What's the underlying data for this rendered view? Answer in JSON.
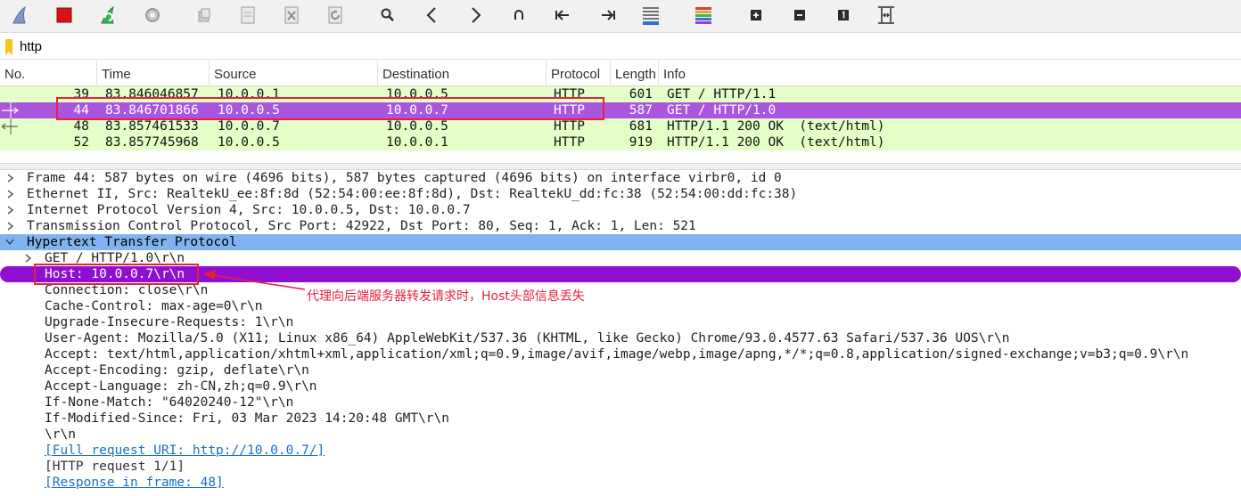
{
  "toolbar": {
    "buttons": [
      {
        "name": "shark-fin-start-icon",
        "color": "#5b6f9e"
      },
      {
        "name": "stop-capture-icon",
        "color": "#d61414"
      },
      {
        "name": "restart-capture-icon",
        "color": "#2da84a"
      },
      {
        "name": "capture-options-gear-icon",
        "color": "#9a9a9a"
      },
      {
        "name": "open-file-icon",
        "color": "#9a9a9a"
      },
      {
        "name": "save-file-icon",
        "color": "#9a9a9a"
      },
      {
        "name": "close-file-icon",
        "color": "#9a9a9a"
      },
      {
        "name": "reload-file-icon",
        "color": "#9a9a9a"
      },
      {
        "name": "find-packet-icon",
        "color": "#2b2b2b"
      },
      {
        "name": "go-back-icon",
        "color": "#2b2b2b"
      },
      {
        "name": "go-forward-icon",
        "color": "#2b2b2b"
      },
      {
        "name": "go-to-packet-icon",
        "color": "#2b2b2b"
      },
      {
        "name": "first-packet-icon",
        "color": "#2b2b2b"
      },
      {
        "name": "last-packet-icon",
        "color": "#2b2b2b"
      },
      {
        "name": "auto-scroll-icon",
        "color": "#2b2b2b"
      },
      {
        "name": "colorize-icon",
        "color": "#2b2b2b"
      },
      {
        "name": "zoom-in-icon",
        "color": "#2b2b2b"
      },
      {
        "name": "zoom-out-icon",
        "color": "#2b2b2b"
      },
      {
        "name": "normal-size-icon",
        "color": "#2b2b2b"
      },
      {
        "name": "resize-columns-icon",
        "color": "#2b2b2b"
      }
    ]
  },
  "filter": {
    "value": "http"
  },
  "packet_list": {
    "columns": [
      "No.",
      "Time",
      "Source",
      "Destination",
      "Protocol",
      "Length",
      "Info"
    ],
    "rows": [
      {
        "no": "39",
        "time": "83.846046857",
        "source": "10.0.0.1",
        "destination": "10.0.0.5",
        "protocol": "HTTP",
        "length": "601",
        "info": "GET / HTTP/1.1"
      },
      {
        "no": "44",
        "time": "83.846701866",
        "source": "10.0.0.5",
        "destination": "10.0.0.7",
        "protocol": "HTTP",
        "length": "587",
        "info": "GET / HTTP/1.0"
      },
      {
        "no": "48",
        "time": "83.857461533",
        "source": "10.0.0.7",
        "destination": "10.0.0.5",
        "protocol": "HTTP",
        "length": "681",
        "info": "HTTP/1.1 200 OK  (text/html)"
      },
      {
        "no": "52",
        "time": "83.857745968",
        "source": "10.0.0.5",
        "destination": "10.0.0.1",
        "protocol": "HTTP",
        "length": "919",
        "info": "HTTP/1.1 200 OK  (text/html)"
      }
    ],
    "row_color": "#e4ffc7",
    "selected_color": "#aa55dd"
  },
  "detail": {
    "frame": "Frame 44: 587 bytes on wire (4696 bits), 587 bytes captured (4696 bits) on interface virbr0, id 0",
    "ethernet": "Ethernet II, Src: RealtekU_ee:8f:8d (52:54:00:ee:8f:8d), Dst: RealtekU_dd:fc:38 (52:54:00:dd:fc:38)",
    "ip": "Internet Protocol Version 4, Src: 10.0.0.5, Dst: 10.0.0.7",
    "tcp": "Transmission Control Protocol, Src Port: 42922, Dst Port: 80, Seq: 1, Ack: 1, Len: 521",
    "http": "Hypertext Transfer Protocol",
    "request_line": "GET / HTTP/1.0\\r\\n",
    "host": "Host: 10.0.0.7\\r\\n",
    "connection": "Connection: close\\r\\n",
    "cache_control": "Cache-Control: max-age=0\\r\\n",
    "upgrade": "Upgrade-Insecure-Requests: 1\\r\\n",
    "user_agent": "User-Agent: Mozilla/5.0 (X11; Linux x86_64) AppleWebKit/537.36 (KHTML, like Gecko) Chrome/93.0.4577.63 Safari/537.36 UOS\\r\\n",
    "accept": "Accept: text/html,application/xhtml+xml,application/xml;q=0.9,image/avif,image/webp,image/apng,*/*;q=0.8,application/signed-exchange;v=b3;q=0.9\\r\\n",
    "accept_encoding": "Accept-Encoding: gzip, deflate\\r\\n",
    "accept_language": "Accept-Language: zh-CN,zh;q=0.9\\r\\n",
    "if_none_match": "If-None-Match: \"64020240-12\"\\r\\n",
    "if_modified_since": "If-Modified-Since: Fri, 03 Mar 2023 14:20:48 GMT\\r\\n",
    "crlf": "\\r\\n",
    "full_uri": "[Full request URI: http://10.0.0.7/]",
    "request_num": "[HTTP request 1/1]",
    "response_in": "[Response in frame: 48]"
  },
  "annotation": {
    "text": "代理向后端服务器转发请求时，Host头部信息丢失",
    "color": "#e8203a"
  }
}
